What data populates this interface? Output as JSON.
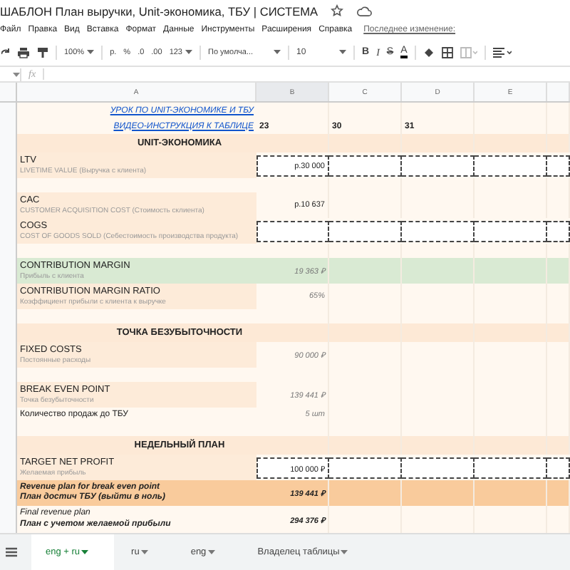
{
  "document": {
    "title": "ШАБЛОН План выручки, Unit-экономика, ТБУ | СИСТЕМА"
  },
  "menu": [
    "Файл",
    "Правка",
    "Вид",
    "Вставка",
    "Формат",
    "Данные",
    "Инструменты",
    "Расширения",
    "Справка"
  ],
  "last_edit": "Последнее изменение:",
  "toolbar": {
    "zoom": "100%",
    "currency": "р.",
    "percent": "%",
    "decrease_decimals": ".0",
    "increase_decimals": ".00",
    "number_format": "123",
    "font": "По умолча...",
    "font_size": "10",
    "bold": "B",
    "italic": "I",
    "strike": "S",
    "text_color": "A"
  },
  "formula_bar": {
    "label": "fx"
  },
  "columns": [
    "A",
    "B",
    "C",
    "D",
    "E"
  ],
  "rows": [
    {
      "kind": "link",
      "text": "УРОК ПО UNIT-ЭКОНОМИКЕ И ТБУ"
    },
    {
      "kind": "link",
      "text": "ВИДЕО-ИНСТРУКЦИЯ К ТАБЛИЦЕ",
      "cells": [
        "23",
        "30",
        "31"
      ]
    },
    {
      "kind": "section",
      "text": "UNIT-ЭКОНОМИКА"
    },
    {
      "kind": "input",
      "title": "LTV",
      "subtitle": "LIVETIME VALUE (Выручка с клиента)",
      "value": "р.30 000"
    },
    {
      "kind": "blank"
    },
    {
      "kind": "metric",
      "title": "CAC",
      "subtitle": "CUSTOMER ACQUISITION COST (Стоимость cклиента)",
      "value": "р.10 637",
      "computed": false
    },
    {
      "kind": "input",
      "title": "COGS",
      "subtitle": "COST OF GOODS SOLD (Себестоимость производства продукта)"
    },
    {
      "kind": "blank"
    },
    {
      "kind": "key",
      "title": "CONTRIBUTION MARGIN",
      "subtitle": "Прибыль с клиента",
      "value": "19 363 ₽",
      "computed": true
    },
    {
      "kind": "metric",
      "title": "CONTRIBUTION MARGIN RATIO",
      "subtitle": "Коэффициент прибыли с клиента к выручке",
      "value": "65%",
      "computed": true
    },
    {
      "kind": "blank"
    },
    {
      "kind": "section",
      "text": "ТОЧКА БЕЗУБЫТОЧНОСТИ"
    },
    {
      "kind": "metric",
      "title": "FIXED COSTS",
      "subtitle": "Постоянные расходы",
      "value": "90 000 ₽",
      "computed": true
    },
    {
      "kind": "blank"
    },
    {
      "kind": "metric",
      "title": "BREAK EVEN POINT",
      "subtitle": "Точка безубыточности",
      "value": "139 441 ₽",
      "computed": true
    },
    {
      "kind": "plain",
      "title": "Количество продаж до ТБУ",
      "value": "5 шт",
      "computed": true
    },
    {
      "kind": "blank"
    },
    {
      "kind": "section",
      "text": "НЕДЕЛЬНЫЙ ПЛАН"
    },
    {
      "kind": "input",
      "title": "TARGET NET PROFIT",
      "subtitle": "Желаемая прибыль",
      "value": "100 000 ₽"
    },
    {
      "kind": "plan",
      "lines": [
        "Revenue plan for break even point",
        "План достич ТБУ (выйти в ноль)"
      ],
      "value": "139 441 ₽"
    },
    {
      "kind": "total",
      "lines": [
        "Final revenue plan",
        "План с учетом желаемой прибыли"
      ],
      "value": "294 376 ₽"
    }
  ],
  "sheet_tabs": [
    {
      "label": "eng + ru",
      "selected": true
    },
    {
      "label": "ru",
      "selected": false
    },
    {
      "label": "eng",
      "selected": false
    },
    {
      "label": "Владелец таблицы",
      "selected": false
    }
  ]
}
